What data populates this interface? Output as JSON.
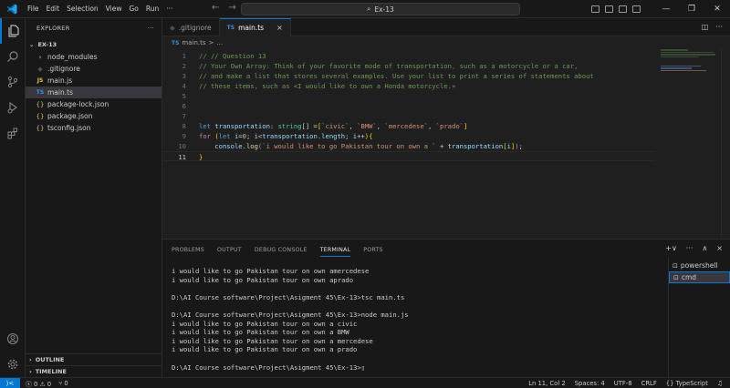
{
  "window": {
    "menu": [
      "File",
      "Edit",
      "Selection",
      "View",
      "Go",
      "Run"
    ],
    "more": "···",
    "search_text": "Ex-13"
  },
  "sidebar": {
    "title": "EXPLORER",
    "more": "···",
    "folder": "EX-13",
    "items": [
      {
        "label": "node_modules",
        "icon": "›",
        "kind": "folder"
      },
      {
        "label": ".gitignore",
        "icon": "◆",
        "kind": "git"
      },
      {
        "label": "main.js",
        "icon": "JS",
        "kind": "js"
      },
      {
        "label": "main.ts",
        "icon": "TS",
        "kind": "ts"
      },
      {
        "label": "package-lock.json",
        "icon": "{}",
        "kind": "json"
      },
      {
        "label": "package.json",
        "icon": "{}",
        "kind": "json"
      },
      {
        "label": "tsconfig.json",
        "icon": "{}",
        "kind": "json"
      }
    ],
    "selected_index": 3,
    "outline": "OUTLINE",
    "timeline": "TIMELINE"
  },
  "tabs": [
    {
      "label": ".gitignore",
      "active": false
    },
    {
      "label": "main.ts",
      "active": true,
      "icon": "TS",
      "close": "×"
    }
  ],
  "breadcrumb": {
    "icon": "TS",
    "file": "main.ts",
    "sep": ">",
    "rest": "..."
  },
  "editor": {
    "lines": [
      {
        "n": "1",
        "tokens": [
          {
            "t": "// // Question 13",
            "c": "c-com"
          }
        ]
      },
      {
        "n": "2",
        "tokens": [
          {
            "t": "// Your Own Array: Think of your favorite mode of transportation, such as a motorcycle or a car,",
            "c": "c-com"
          }
        ]
      },
      {
        "n": "3",
        "tokens": [
          {
            "t": "// and make a list that stores several examples. Use your list to print a series of statements about",
            "c": "c-com"
          }
        ]
      },
      {
        "n": "4",
        "tokens": [
          {
            "t": "// these items, such as <I would like to own a Honda motorcycle.»",
            "c": "c-com"
          }
        ]
      },
      {
        "n": "5",
        "tokens": []
      },
      {
        "n": "6",
        "tokens": []
      },
      {
        "n": "7",
        "tokens": []
      },
      {
        "n": "8",
        "tokens": [
          {
            "t": "let ",
            "c": "c-kw"
          },
          {
            "t": "transportation",
            "c": "c-var"
          },
          {
            "t": ": ",
            "c": "c-pun"
          },
          {
            "t": "string",
            "c": "c-type"
          },
          {
            "t": "[] =",
            "c": "c-pun"
          },
          {
            "t": "[",
            "c": "c-br1"
          },
          {
            "t": "`civic`",
            "c": "c-str"
          },
          {
            "t": ", ",
            "c": "c-pun"
          },
          {
            "t": "`BMW`",
            "c": "c-str"
          },
          {
            "t": ", ",
            "c": "c-pun"
          },
          {
            "t": "`mercedese`",
            "c": "c-str"
          },
          {
            "t": ", ",
            "c": "c-pun"
          },
          {
            "t": "`prado`",
            "c": "c-str"
          },
          {
            "t": "]",
            "c": "c-br1"
          }
        ]
      },
      {
        "n": "9",
        "tokens": [
          {
            "t": "for ",
            "c": "c-ctl"
          },
          {
            "t": "(",
            "c": "c-br1"
          },
          {
            "t": "let ",
            "c": "c-kw"
          },
          {
            "t": "i",
            "c": "c-var"
          },
          {
            "t": "=",
            "c": "c-pun"
          },
          {
            "t": "0",
            "c": "c-num"
          },
          {
            "t": "; ",
            "c": "c-pun"
          },
          {
            "t": "i",
            "c": "c-var"
          },
          {
            "t": "<",
            "c": "c-pun"
          },
          {
            "t": "transportation",
            "c": "c-var"
          },
          {
            "t": ".",
            "c": "c-pun"
          },
          {
            "t": "length",
            "c": "c-var"
          },
          {
            "t": "; ",
            "c": "c-pun"
          },
          {
            "t": "i",
            "c": "c-var"
          },
          {
            "t": "++",
            "c": "c-pun"
          },
          {
            "t": ")",
            "c": "c-br1"
          },
          {
            "t": "{",
            "c": "c-br1"
          }
        ]
      },
      {
        "n": "10",
        "tokens": [
          {
            "t": "    console",
            "c": "c-var"
          },
          {
            "t": ".",
            "c": "c-pun"
          },
          {
            "t": "log",
            "c": "c-fn"
          },
          {
            "t": "(",
            "c": "c-br2"
          },
          {
            "t": "`i would like to go Pakistan tour on own a `",
            "c": "c-str"
          },
          {
            "t": " + ",
            "c": "c-pun"
          },
          {
            "t": "transportation",
            "c": "c-var"
          },
          {
            "t": "[",
            "c": "c-br1"
          },
          {
            "t": "i",
            "c": "c-var"
          },
          {
            "t": "]",
            "c": "c-br1"
          },
          {
            "t": ")",
            "c": "c-br2"
          },
          {
            "t": ";",
            "c": "c-pun"
          }
        ]
      },
      {
        "n": "11",
        "tokens": [
          {
            "t": "}",
            "c": "c-br1"
          }
        ]
      }
    ],
    "current_line": "11"
  },
  "panel": {
    "tabs": [
      "PROBLEMS",
      "OUTPUT",
      "DEBUG CONSOLE",
      "TERMINAL",
      "PORTS"
    ],
    "active_tab": "TERMINAL",
    "actions": [
      "+∨",
      "···",
      "∧",
      "×"
    ],
    "terminal_lines": [
      "i would like to go Pakistan tour on own amercedese",
      "i would like to go Pakistan tour on own aprado",
      "",
      "D:\\AI Course software\\Project\\Asigment 45\\Ex-13>tsc main.ts",
      "",
      "D:\\AI Course software\\Project\\Asigment 45\\Ex-13>node main.js",
      "i would like to go Pakistan tour on own a civic",
      "i would like to go Pakistan tour on own a BMW",
      "i would like to go Pakistan tour on own a mercedese",
      "i would like to go Pakistan tour on own a prado",
      "",
      "D:\\AI Course software\\Project\\Asigment 45\\Ex-13>▯"
    ],
    "terminals": [
      {
        "label": "powershell",
        "selected": false
      },
      {
        "label": "cmd",
        "selected": true
      }
    ]
  },
  "statusbar": {
    "remote": "⟩<",
    "errors": "0",
    "warnings": "0",
    "ports": "0",
    "ln_col": "Ln 11, Col 2",
    "spaces": "Spaces: 4",
    "encoding": "UTF-8",
    "eol": "CRLF",
    "lang_braces": "{}",
    "language": "TypeScript",
    "bell": "🔔"
  },
  "colors": {
    "accent": "#0078d4",
    "background": "#1f1f1f",
    "sidebar": "#181818"
  }
}
